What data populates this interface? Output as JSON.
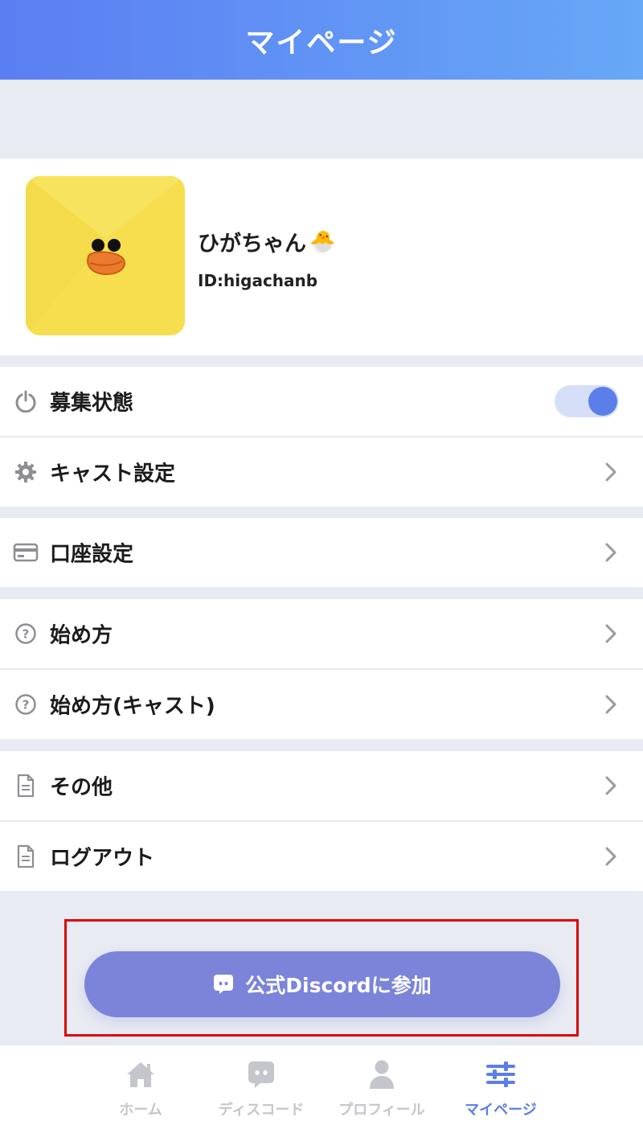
{
  "header": {
    "title": "マイページ"
  },
  "profile": {
    "name": "ひがちゃん",
    "name_emoji": "🐣",
    "id_text": "ID:higachanb"
  },
  "menu": {
    "recruit_label": "募集状態",
    "recruit_toggle_on": true,
    "cast_settings_label": "キャスト設定",
    "account_settings_label": "口座設定",
    "how_to_label": "始め方",
    "how_to_cast_label": "始め方(キャスト)",
    "other_label": "その他",
    "logout_label": "ログアウト"
  },
  "discord": {
    "label": "公式Discordに参加"
  },
  "tabs": [
    {
      "label": "ホーム",
      "icon": "home-icon",
      "active": false
    },
    {
      "label": "ディスコード",
      "icon": "discord-icon",
      "active": false
    },
    {
      "label": "プロフィール",
      "icon": "person-icon",
      "active": false
    },
    {
      "label": "マイページ",
      "icon": "sliders-icon",
      "active": true
    }
  ],
  "colors": {
    "accent": "#5b7ee8",
    "header_gradient_start": "#5b7ef2",
    "header_gradient_end": "#67a8f7",
    "discord_button": "#7b84d9",
    "highlight_border": "#e00000",
    "background": "#e9ebf3"
  }
}
